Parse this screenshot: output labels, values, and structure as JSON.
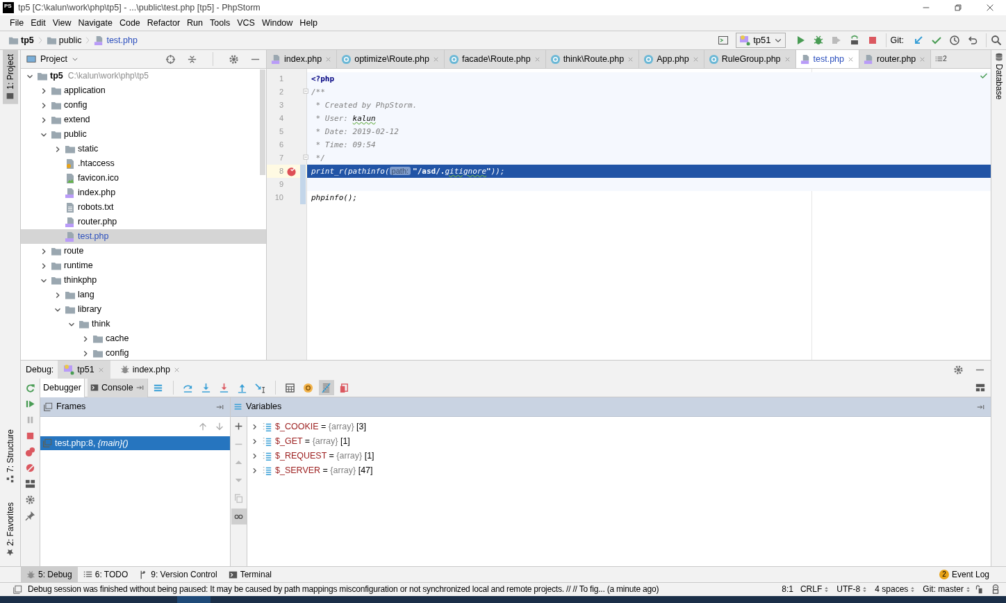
{
  "window": {
    "logo": "PS",
    "title": "tp5 [C:\\kalun\\work\\php\\tp5] - ...\\public\\test.php [tp5] - PhpStorm"
  },
  "menu": [
    "File",
    "Edit",
    "View",
    "Navigate",
    "Code",
    "Refactor",
    "Run",
    "Tools",
    "VCS",
    "Window",
    "Help"
  ],
  "breadcrumbs": [
    {
      "label": "tp5",
      "kind": "root",
      "modified": false
    },
    {
      "label": "public",
      "kind": "folder",
      "modified": false
    },
    {
      "label": "test.php",
      "kind": "php",
      "modified": true
    }
  ],
  "run_toolbar": {
    "config": "tp51",
    "vcs_label": "Git:"
  },
  "left_stripe": {
    "top": [
      {
        "label": "1: Project",
        "kind": "project",
        "selected": true
      }
    ],
    "bottom": [
      {
        "label": "7: Structure",
        "kind": "structure",
        "selected": false
      },
      {
        "label": "2: Favorites",
        "kind": "favorites",
        "selected": false
      }
    ]
  },
  "right_stripe": [
    {
      "label": "Database",
      "selected": false
    }
  ],
  "project": {
    "title": "Project",
    "tree": [
      {
        "label": "tp5",
        "kind": "root",
        "note": "C:\\kalun\\work\\php\\tp5",
        "expanded": true,
        "selected": false,
        "modified": false,
        "children": [
          {
            "label": "application",
            "kind": "folder",
            "expanded": false,
            "selected": false,
            "modified": false
          },
          {
            "label": "config",
            "kind": "folder",
            "expanded": false,
            "selected": false,
            "modified": false
          },
          {
            "label": "extend",
            "kind": "folder",
            "expanded": false,
            "selected": false,
            "modified": false
          },
          {
            "label": "public",
            "kind": "folder",
            "expanded": true,
            "selected": false,
            "modified": false,
            "children": [
              {
                "label": "static",
                "kind": "folder",
                "expanded": false,
                "selected": false,
                "modified": false
              },
              {
                "label": ".htaccess",
                "kind": "config",
                "selected": false,
                "modified": false
              },
              {
                "label": "favicon.ico",
                "kind": "image",
                "selected": false,
                "modified": false
              },
              {
                "label": "index.php",
                "kind": "php",
                "selected": false,
                "modified": false
              },
              {
                "label": "robots.txt",
                "kind": "text",
                "selected": false,
                "modified": false
              },
              {
                "label": "router.php",
                "kind": "php",
                "selected": false,
                "modified": false
              },
              {
                "label": "test.php",
                "kind": "php",
                "selected": true,
                "modified": true
              }
            ]
          },
          {
            "label": "route",
            "kind": "folder",
            "expanded": false,
            "selected": false,
            "modified": false
          },
          {
            "label": "runtime",
            "kind": "folder",
            "expanded": false,
            "selected": false,
            "modified": false
          },
          {
            "label": "thinkphp",
            "kind": "folder",
            "expanded": true,
            "selected": false,
            "modified": false,
            "children": [
              {
                "label": "lang",
                "kind": "folder",
                "expanded": false,
                "selected": false,
                "modified": false
              },
              {
                "label": "library",
                "kind": "folder",
                "expanded": true,
                "selected": false,
                "modified": false,
                "children": [
                  {
                    "label": "think",
                    "kind": "folder",
                    "expanded": true,
                    "selected": false,
                    "modified": false,
                    "children": [
                      {
                        "label": "cache",
                        "kind": "folder",
                        "expanded": false,
                        "selected": false,
                        "modified": false
                      },
                      {
                        "label": "config",
                        "kind": "folder",
                        "expanded": false,
                        "selected": false,
                        "modified": false
                      }
                    ]
                  }
                ]
              }
            ]
          }
        ]
      }
    ]
  },
  "editor": {
    "tabs": [
      {
        "label": "index.php",
        "kind": "php",
        "selected": false,
        "modified": false
      },
      {
        "label": "optimize\\Route.php",
        "kind": "class",
        "selected": false,
        "modified": false
      },
      {
        "label": "facade\\Route.php",
        "kind": "class",
        "selected": false,
        "modified": false
      },
      {
        "label": "think\\Route.php",
        "kind": "class",
        "selected": false,
        "modified": false
      },
      {
        "label": "App.php",
        "kind": "class",
        "selected": false,
        "modified": false
      },
      {
        "label": "RuleGroup.php",
        "kind": "class",
        "selected": false,
        "modified": false
      },
      {
        "label": "test.php",
        "kind": "php",
        "selected": true,
        "modified": true
      },
      {
        "label": "router.php",
        "kind": "php",
        "selected": false,
        "modified": false
      }
    ],
    "overflow_count": "2",
    "lines": [
      {
        "number": "1",
        "fold": false,
        "breakpoint": false,
        "current": false,
        "changed": false,
        "in_scope": true,
        "tokens": [
          {
            "text": "<?php",
            "kind": "tag"
          }
        ]
      },
      {
        "number": "2",
        "fold": true,
        "breakpoint": false,
        "current": false,
        "changed": false,
        "in_scope": true,
        "tokens": [
          {
            "text": "/**",
            "kind": "comment"
          }
        ]
      },
      {
        "number": "3",
        "fold": false,
        "breakpoint": false,
        "current": false,
        "changed": false,
        "in_scope": true,
        "tokens": [
          {
            "text": " * Created by PhpStorm.",
            "kind": "comment"
          }
        ]
      },
      {
        "number": "4",
        "fold": false,
        "breakpoint": false,
        "current": false,
        "changed": false,
        "in_scope": true,
        "tokens": [
          {
            "text": " * User: ",
            "kind": "comment"
          },
          {
            "text": "kalun",
            "kind": "typo"
          }
        ]
      },
      {
        "number": "5",
        "fold": false,
        "breakpoint": false,
        "current": false,
        "changed": false,
        "in_scope": true,
        "tokens": [
          {
            "text": " * Date: 2019-02-12",
            "kind": "comment"
          }
        ]
      },
      {
        "number": "6",
        "fold": false,
        "breakpoint": false,
        "current": false,
        "changed": false,
        "in_scope": true,
        "tokens": [
          {
            "text": " * Time: 09:54",
            "kind": "comment"
          }
        ]
      },
      {
        "number": "7",
        "fold": true,
        "breakpoint": false,
        "current": false,
        "changed": false,
        "in_scope": true,
        "tokens": [
          {
            "text": " */",
            "kind": "comment"
          }
        ]
      },
      {
        "number": "8",
        "fold": false,
        "breakpoint": true,
        "current": true,
        "changed": true,
        "in_scope": true,
        "tokens": [
          {
            "text": "print_r(pathinfo(",
            "kind": "call"
          },
          {
            "text": "path:",
            "kind": "hint"
          },
          {
            "text": "\"/asd/.",
            "kind": "string"
          },
          {
            "text": "gitignore",
            "kind": "typo"
          },
          {
            "text": "\"",
            "kind": "string"
          },
          {
            "text": "));",
            "kind": "plain"
          }
        ]
      },
      {
        "number": "9",
        "fold": false,
        "breakpoint": false,
        "current": false,
        "changed": true,
        "in_scope": true
      },
      {
        "number": "10",
        "fold": false,
        "breakpoint": false,
        "current": false,
        "changed": true,
        "in_scope": false,
        "tokens": [
          {
            "text": "phpinfo",
            "kind": "call"
          },
          {
            "text": "();",
            "kind": "plain"
          }
        ]
      }
    ]
  },
  "debug": {
    "label": "Debug:",
    "sessions": [
      {
        "label": "tp51",
        "kind": "php",
        "selected": true
      },
      {
        "label": "index.php",
        "kind": "bug",
        "selected": false
      }
    ],
    "tabs": [
      {
        "label": "Debugger",
        "kind": "debugger",
        "selected": true
      },
      {
        "label": "Console",
        "kind": "console",
        "selected": false
      }
    ],
    "toolbar": [
      {
        "kind": "frames",
        "on": false
      },
      {
        "kind": "step-over",
        "on": false
      },
      {
        "kind": "step-into",
        "on": false
      },
      {
        "kind": "force-step-into",
        "on": false
      },
      {
        "kind": "step-out",
        "on": false
      },
      {
        "kind": "run-to-cursor",
        "on": false
      },
      {
        "kind": "evaluate",
        "on": false
      },
      {
        "kind": "watch",
        "on": false
      },
      {
        "kind": "stripes",
        "on": true
      },
      {
        "kind": "restore",
        "on": false
      }
    ],
    "actions": [
      {
        "kind": "rerun",
        "disabled": false
      },
      {
        "kind": "resume",
        "disabled": false
      },
      {
        "kind": "pause",
        "disabled": true
      },
      {
        "kind": "stop",
        "disabled": false
      },
      {
        "kind": "breakpoints",
        "disabled": false
      },
      {
        "kind": "mute",
        "disabled": false
      },
      {
        "kind": "layout",
        "disabled": false
      },
      {
        "kind": "settings",
        "disabled": false
      },
      {
        "kind": "pin",
        "disabled": false
      }
    ],
    "frames": {
      "title": "Frames",
      "items": [
        {
          "text": "test.php:8, *{main}()*",
          "selected": true
        }
      ]
    },
    "variables": {
      "title": "Variables",
      "buttons": [
        {
          "kind": "plus",
          "on": false,
          "disabled": false
        },
        {
          "kind": "minus",
          "on": false,
          "disabled": true
        },
        {
          "kind": "up",
          "on": false,
          "disabled": true
        },
        {
          "kind": "down",
          "on": false,
          "disabled": true
        },
        {
          "kind": "copy",
          "on": false,
          "disabled": true
        },
        {
          "kind": "glasses",
          "on": true,
          "disabled": false
        }
      ],
      "items": [
        {
          "name": "$_COOKIE",
          "op": "=",
          "type": "{array}",
          "count": "[3]"
        },
        {
          "name": "$_GET",
          "op": "=",
          "type": "{array}",
          "count": "[1]"
        },
        {
          "name": "$_REQUEST",
          "op": "=",
          "type": "{array}",
          "count": "[1]"
        },
        {
          "name": "$_SERVER",
          "op": "=",
          "type": "{array}",
          "count": "[47]"
        }
      ]
    }
  },
  "tool_windows": [
    {
      "label": "5: Debug",
      "kind": "debug",
      "selected": true
    },
    {
      "label": "6: TODO",
      "kind": "todo",
      "selected": false
    },
    {
      "label": "9: Version Control",
      "kind": "vcs",
      "selected": false
    },
    {
      "label": "Terminal",
      "kind": "terminal",
      "selected": false
    }
  ],
  "event_log": {
    "count": "2",
    "label": "Event Log"
  },
  "status_bar": {
    "message": "Debug session was finished without being paused: It may be caused by path mappings misconfiguration or not synchronized local and remote projects. // // To fig... (a minute ago)",
    "items": [
      {
        "text": "8:1",
        "menu": false
      },
      {
        "text": "CRLF",
        "menu": true
      },
      {
        "text": "UTF-8",
        "menu": true
      },
      {
        "text": "4 spaces",
        "menu": true
      },
      {
        "text": "Git: master",
        "menu": true
      }
    ]
  }
}
